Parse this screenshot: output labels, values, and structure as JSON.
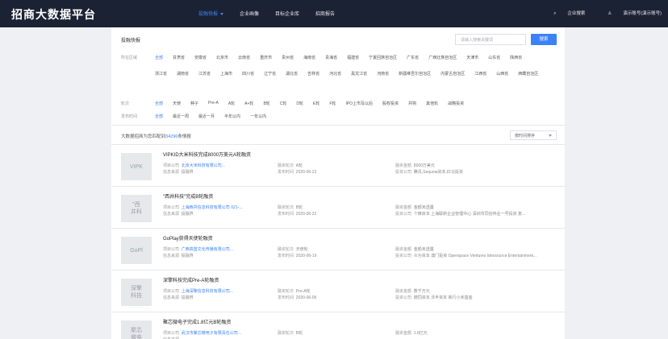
{
  "header": {
    "logo": "招商大数据平台",
    "nav": [
      {
        "label": "投融快报",
        "active": true
      },
      {
        "label": "企业画像",
        "active": false
      },
      {
        "label": "目标企业库",
        "active": false
      },
      {
        "label": "招商报告",
        "active": false
      }
    ],
    "right": {
      "enterprise": "企业搜索",
      "account": "演示账号(演示账号)"
    }
  },
  "filter": {
    "title": "投融快报",
    "search_placeholder": "请输入搜索关键词",
    "search_button": "搜索",
    "region_label": "所在区域",
    "regions": [
      "全部",
      "甘肃省",
      "安徽省",
      "北京市",
      "云南省",
      "重庆市",
      "贵州省",
      "海南省",
      "青海省",
      "福建省",
      "宁夏回族自治区",
      "广东省",
      "广西壮族自治区",
      "天津市",
      "山东省",
      "陕西省",
      "浙江省",
      "湖南省",
      "江苏省",
      "上海市",
      "四川省",
      "辽宁省",
      "湖北省",
      "吉林省",
      "河北省",
      "黑龙江省",
      "河南省",
      "新疆维吾尔自治区",
      "内蒙古自治区",
      "江西省",
      "山西省",
      "西藏自治区"
    ],
    "round_label": "轮次",
    "rounds": [
      "全部",
      "天使",
      "种子",
      "Pre-A",
      "A轮",
      "A+轮",
      "B轮",
      "C轮",
      "D轮",
      "E轮",
      "F轮",
      "IPO上市及以后",
      "股权投资",
      "并购",
      "其他轮",
      "战略投资"
    ],
    "time_label": "发布时间",
    "times": [
      "全部",
      "最近一周",
      "最近一月",
      "半年以内",
      "一年以内"
    ]
  },
  "results": {
    "prefix": "大数据招商为您匹配到",
    "count": "34296",
    "suffix": "条情报",
    "sort": "按时间排序"
  },
  "news": [
    {
      "thumb": "VIPK",
      "title": "VIPKID大米科技完成8000万美元A轮融资",
      "company_label": "项目公司",
      "company": "北京大米科技有限公司...",
      "source_label": "信息来源",
      "source": "投融界",
      "round_label": "融资轮次",
      "round": "A轮",
      "date_label": "发布时间",
      "date": "2020-06-22",
      "amount_label": "融资金额",
      "amount": "8000万美元",
      "investor_label": "投资公司",
      "investor": "腾讯,Sequoia资本,红马投资"
    },
    {
      "thumb": "\"西\n井科",
      "title": "\"西井科技\"完成B轮融资",
      "company_label": "项目公司",
      "company": "上海西井信息科技有限公司 021-...",
      "source_label": "信息来源",
      "source": "投融界",
      "round_label": "融资轮次",
      "round": "B轮",
      "date_label": "发布时间",
      "date": "2020-06-22",
      "amount_label": "融资金额",
      "amount": "金额未透露",
      "investor_label": "投资公司",
      "investor": "个推资本 上海联新企业管理中心 深圳市同创伟业一号投资 复..."
    },
    {
      "thumb": "GoPl",
      "title": "GoPlay获得天使轮融资",
      "company_label": "项目公司",
      "company": "广西高盟文化传播有限公司...",
      "source_label": "信息来源",
      "source": "投融界",
      "round_label": "融资轮次",
      "round": "天使轮",
      "date_label": "发布时间",
      "date": "2020-06-19",
      "amount_label": "融资金额",
      "amount": "金额未透露",
      "investor_label": "投资公司",
      "investor": "众为资本 澳门投资 Openspace Ventures Ideosource Entertainment..."
    },
    {
      "thumb": "深擎\n科技",
      "title": "深擎科技完成Pre-A轮融资",
      "company_label": "项目公司",
      "company": "上海深擎信息科技有限公司...",
      "source_label": "信息来源",
      "source": "投融界",
      "round_label": "融资轮次",
      "round": "Pre-A轮",
      "date_label": "发布时间",
      "date": "2020-06-06",
      "amount_label": "融资金额",
      "amount": "数千万元",
      "investor_label": "投资公司",
      "investor": "德同资本 沃丰资本 新行小禾基金"
    },
    {
      "thumb": "聚芯\n微电",
      "title": "聚芯微电子完成1.8亿元B轮融资",
      "company_label": "项目公司",
      "company": "武汉市聚芯微电子有限责任公司...",
      "source_label": "信息来源",
      "source": "",
      "round_label": "融资轮次",
      "round": "B轮",
      "date_label": "",
      "date": "",
      "amount_label": "融资金额",
      "amount": "1.8亿元",
      "investor_label": "",
      "investor": ""
    }
  ]
}
